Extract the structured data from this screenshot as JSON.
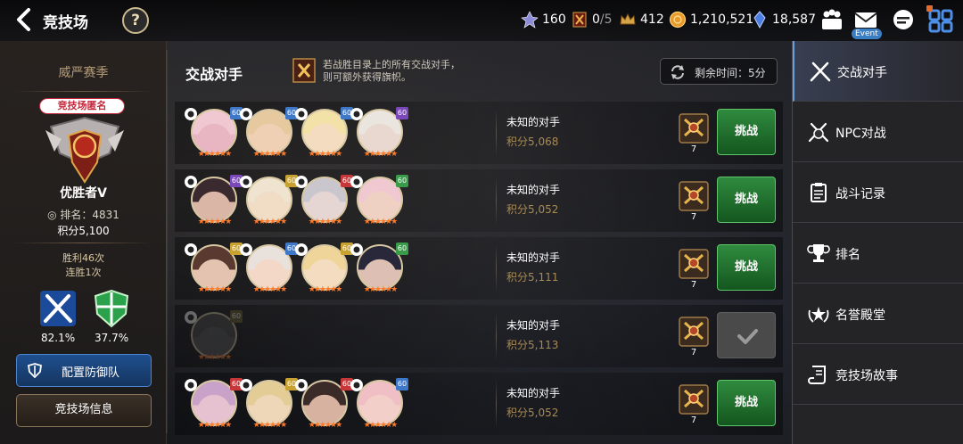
{
  "header": {
    "title": "竞技场",
    "help_label": "?",
    "resources": [
      {
        "name": "rank-token",
        "value": "160"
      },
      {
        "name": "flag",
        "value": "0",
        "max": "/5"
      },
      {
        "name": "crown",
        "value": "412"
      },
      {
        "name": "gold",
        "value": "1,210,521"
      },
      {
        "name": "crystal",
        "value": "18,587"
      }
    ],
    "event_label": "Event"
  },
  "left": {
    "season": "威严赛季",
    "anonymous_label": "竞技场匿名",
    "rank_name": "优胜者V",
    "rank_number": "排名：4831",
    "score": "积分5,100",
    "wins": "胜利46次",
    "streak": "连胜1次",
    "attack_rate": "82.1%",
    "defense_rate": "37.7%",
    "defense_button": "配置防御队",
    "info_button": "竞技场信息"
  },
  "middle": {
    "title": "交战对手",
    "tip_line1": "若战胜目录上的所有交战对手，",
    "tip_line2": "则可额外获得旗帜。",
    "timer": "剩余时间：5分"
  },
  "opponents": [
    {
      "name": "未知的对手",
      "score": "积分5,068",
      "rank_count": "7",
      "button": "挑战",
      "done": false,
      "heroes": [
        {
          "lv": "60",
          "lvc": "#3f78c9",
          "face": "#e8b6c2",
          "hair": "#f0c8d2",
          "stars": "★★★★★★"
        },
        {
          "lv": "60",
          "lvc": "#3f78c9",
          "face": "#f0d0b4",
          "hair": "#e7c9a0",
          "stars": "★★★★★★"
        },
        {
          "lv": "60",
          "lvc": "#3f78c9",
          "face": "#f3dcc0",
          "hair": "#f2e2a8",
          "stars": "★★★★★★"
        },
        {
          "lv": "60",
          "lvc": "#7a48b8",
          "face": "#e9d8cf",
          "hair": "#ebe5e0",
          "stars": "★★★★★★"
        }
      ]
    },
    {
      "name": "未知的对手",
      "score": "积分5,052",
      "rank_count": "7",
      "button": "挑战",
      "done": false,
      "heroes": [
        {
          "lv": "60",
          "lvc": "#7a48b8",
          "face": "#d9b6a5",
          "hair": "#3a2a30",
          "stars": "★★★★★★"
        },
        {
          "lv": "60",
          "lvc": "#c7a233",
          "face": "#f1dcc6",
          "hair": "#efe4cf",
          "stars": "★★★★★★"
        },
        {
          "lv": "60",
          "lvc": "#c7373a",
          "face": "#e6d6d3",
          "hair": "#c9c6ce",
          "stars": "★★★★★★"
        },
        {
          "lv": "60",
          "lvc": "#3a9b4a",
          "face": "#efd1c3",
          "hair": "#f0c8d2",
          "stars": "★★★★★★"
        }
      ]
    },
    {
      "name": "未知的对手",
      "score": "积分5,111",
      "rank_count": "7",
      "button": "挑战",
      "done": false,
      "heroes": [
        {
          "lv": "60",
          "lvc": "#c7a233",
          "face": "#e4c3b0",
          "hair": "#5a3a30",
          "stars": "★★★★★★"
        },
        {
          "lv": "60",
          "lvc": "#3f78c9",
          "face": "#f3d8c8",
          "hair": "#e9e2dc",
          "stars": "★★★★★★"
        },
        {
          "lv": "60",
          "lvc": "#c7a233",
          "face": "#f4dcc0",
          "hair": "#f0d59a",
          "stars": "★★★★★★"
        },
        {
          "lv": "60",
          "lvc": "#3a9b4a",
          "face": "#ddc0b3",
          "hair": "#28283a",
          "stars": "★★★★★★"
        }
      ]
    },
    {
      "name": "未知的对手",
      "score": "积分5,113",
      "rank_count": "7",
      "button": "",
      "done": true,
      "heroes": [
        {
          "lv": "60",
          "lvc": "#6b6030",
          "face": "#5a5a5a",
          "hair": "#4a4a4a",
          "stars": "★★★★★★"
        }
      ]
    },
    {
      "name": "未知的对手",
      "score": "积分5,052",
      "rank_count": "7",
      "button": "挑战",
      "done": false,
      "heroes": [
        {
          "lv": "60",
          "lvc": "#c7373a",
          "face": "#e6c2d0",
          "hair": "#c8a2c8",
          "stars": "★★★★★★"
        },
        {
          "lv": "60",
          "lvc": "#c7a233",
          "face": "#eed6b8",
          "hair": "#e3cc96",
          "stars": "★★★★★★"
        },
        {
          "lv": "60",
          "lvc": "#c7373a",
          "face": "#d8b2a0",
          "hair": "#3a2a28",
          "stars": "★★★★★★"
        },
        {
          "lv": "60",
          "lvc": "#3f78c9",
          "face": "#f2cfc8",
          "hair": "#f0bfc6",
          "stars": "★★★★★★"
        }
      ]
    }
  ],
  "menu": [
    {
      "label": "交战对手",
      "icon": "crossed-swords-icon",
      "active": true
    },
    {
      "label": "NPC对战",
      "icon": "npc-battle-icon",
      "active": false
    },
    {
      "label": "战斗记录",
      "icon": "clipboard-icon",
      "active": false
    },
    {
      "label": "排名",
      "icon": "trophy-icon",
      "active": false
    },
    {
      "label": "名誉殿堂",
      "icon": "laurel-star-icon",
      "active": false
    },
    {
      "label": "竞技场故事",
      "icon": "scroll-icon",
      "active": false
    }
  ]
}
